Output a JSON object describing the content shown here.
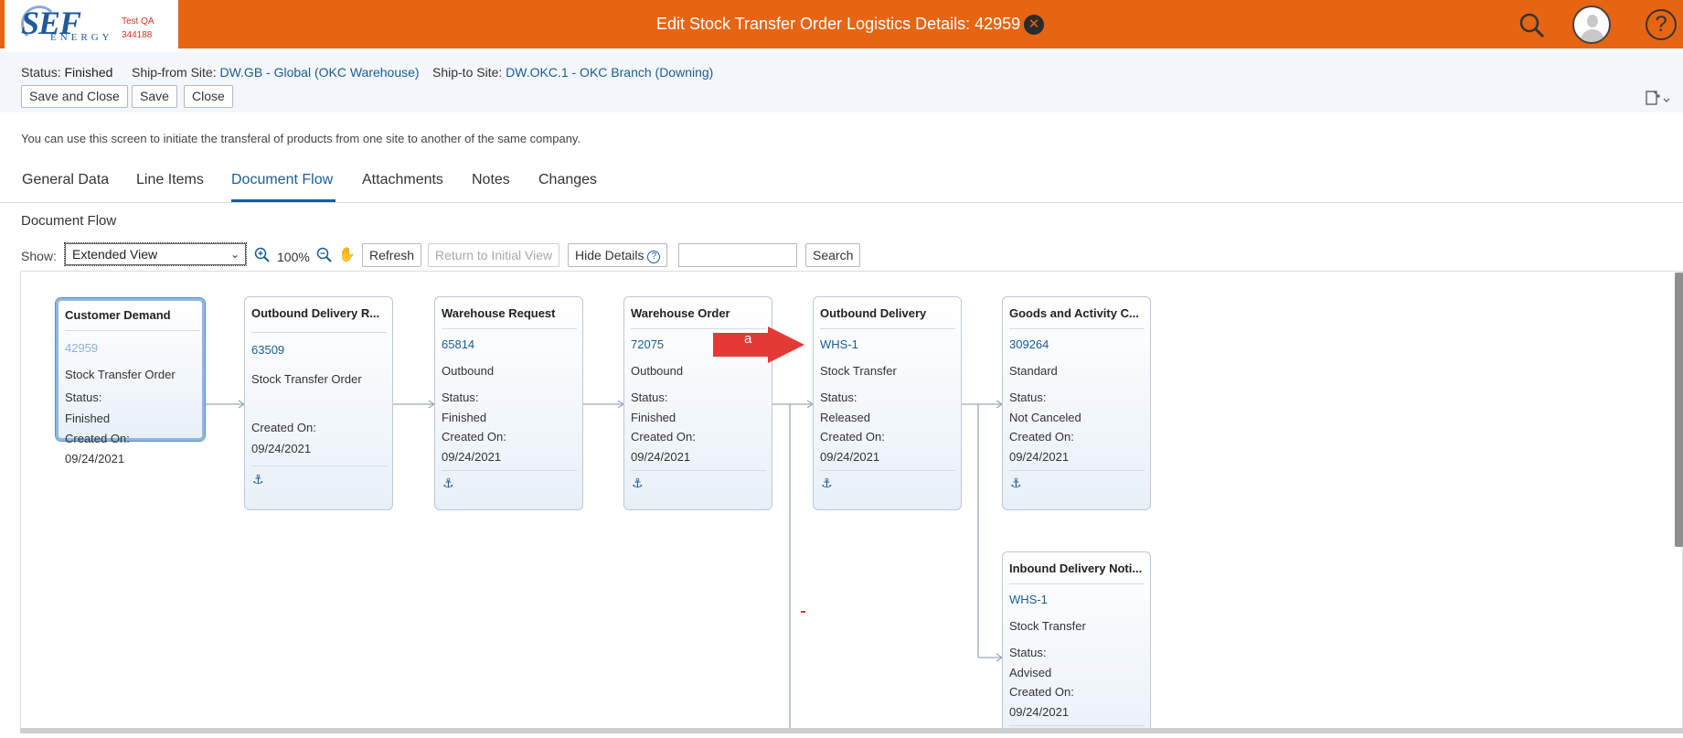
{
  "header": {
    "logo_text": "SEF",
    "logo_sub": "ENERGY",
    "system_label": "Test QA",
    "system_id": "344188",
    "title": "Edit Stock Transfer Order Logistics Details: 42959",
    "brand_color": "#e66513"
  },
  "subheader": {
    "status_label": "Status:",
    "status_value": "Finished",
    "ship_from_label": "Ship-from Site:",
    "ship_from_value": "DW.GB - Global (OKC Warehouse)",
    "ship_to_label": "Ship-to Site:",
    "ship_to_value": "DW.OKC.1 - OKC Branch (Downing)",
    "buttons": {
      "save_close": "Save and Close",
      "save": "Save",
      "close": "Close"
    }
  },
  "description": "You can use this screen to initiate the transferal of products from one site to another of the same company.",
  "tabs": [
    {
      "label": "General Data"
    },
    {
      "label": "Line Items"
    },
    {
      "label": "Document Flow",
      "active": true
    },
    {
      "label": "Attachments"
    },
    {
      "label": "Notes"
    },
    {
      "label": "Changes"
    }
  ],
  "section_title": "Document Flow",
  "toolbar": {
    "show_label": "Show:",
    "show_value": "Extended View",
    "zoom": "100%",
    "refresh": "Refresh",
    "return_initial": "Return to Initial View",
    "hide_details": "Hide Details",
    "search_value": "",
    "search_button": "Search"
  },
  "flow_nodes": [
    {
      "title": "Customer Demand",
      "id": "42959",
      "type": "Stock Transfer Order",
      "status_label": "Status:",
      "status": "Finished",
      "created_label": "Created On:",
      "created": "09/24/2021"
    },
    {
      "title": "Outbound Delivery R...",
      "id": "63509",
      "type": "Stock Transfer Order",
      "created_label": "Created On:",
      "created": "09/24/2021"
    },
    {
      "title": "Warehouse Request",
      "id": "65814",
      "type": "Outbound",
      "status_label": "Status:",
      "status": "Finished",
      "created_label": "Created On:",
      "created": "09/24/2021"
    },
    {
      "title": "Warehouse Order",
      "id": "72075",
      "type": "Outbound",
      "status_label": "Status:",
      "status": "Finished",
      "created_label": "Created On:",
      "created": "09/24/2021"
    },
    {
      "title": "Outbound Delivery",
      "id": "WHS-1",
      "type": "Stock Transfer",
      "status_label": "Status:",
      "status": "Released",
      "created_label": "Created On:",
      "created": "09/24/2021"
    },
    {
      "title": "Goods and Activity C...",
      "id": "309264",
      "type": "Standard",
      "status_label": "Status:",
      "status": "Not Canceled",
      "created_label": "Created On:",
      "created": "09/24/2021"
    },
    {
      "title": "Inbound Delivery Noti...",
      "id": "WHS-1",
      "type": "Stock Transfer",
      "status_label": "Status:",
      "status": "Advised",
      "created_label": "Created On:",
      "created": "09/24/2021"
    }
  ],
  "callout": {
    "label": "a",
    "color": "#e53935"
  }
}
